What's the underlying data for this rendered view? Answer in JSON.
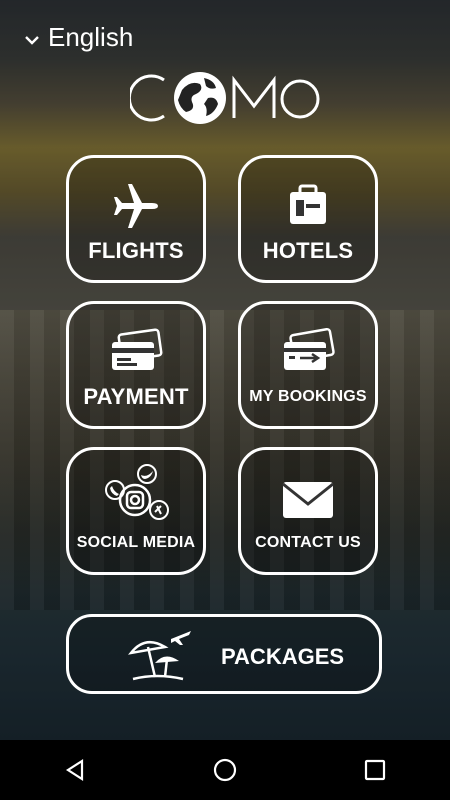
{
  "language": {
    "label": "English"
  },
  "logo": {
    "text": "COMO"
  },
  "tiles": {
    "flights": {
      "label": "FLIGHTS"
    },
    "hotels": {
      "label": "HOTELS"
    },
    "payment": {
      "label": "PAYMENT"
    },
    "bookings": {
      "label": "MY BOOKINGS"
    },
    "social": {
      "label": "SOCIAL MEDIA"
    },
    "contact": {
      "label": "CONTACT US"
    }
  },
  "packages": {
    "label": "PACKAGES"
  },
  "navbar": {
    "icons": [
      "back-icon",
      "home-icon",
      "recents-icon"
    ]
  },
  "colors": {
    "foreground": "#ffffff",
    "navbar": "#000000"
  }
}
